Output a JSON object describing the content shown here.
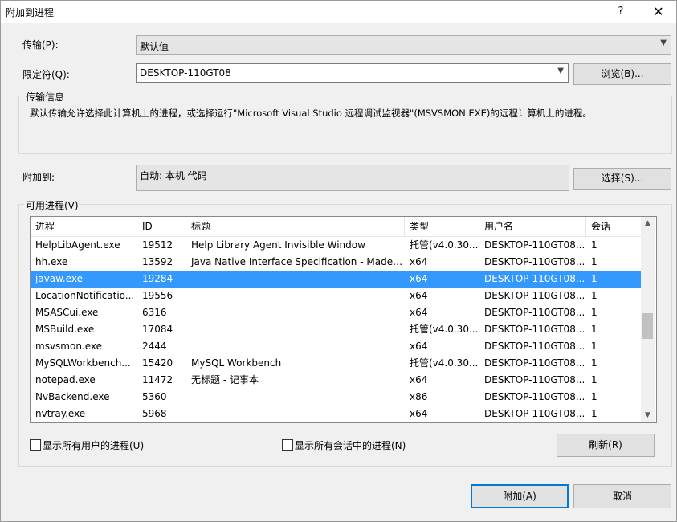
{
  "window": {
    "title": "附加到进程",
    "help_glyph": "?",
    "close_glyph": "✕"
  },
  "transport": {
    "label": "传输(P):",
    "value": "默认值"
  },
  "qualifier": {
    "label": "限定符(Q):",
    "value": "DESKTOP-110GT08"
  },
  "browse_button": "浏览(B)...",
  "transport_info": {
    "title": "传输信息",
    "text": "默认传输允许选择此计算机上的进程，或选择运行\"Microsoft Visual Studio 远程调试监视器\"(MSVSMON.EXE)的远程计算机上的进程。"
  },
  "attach_to": {
    "label": "附加到:",
    "value": "自动: 本机 代码"
  },
  "select_button": "选择(S)...",
  "available_processes": {
    "title": "可用进程(V)",
    "columns": [
      "进程",
      "ID",
      "标题",
      "类型",
      "用户名",
      "会话"
    ],
    "rows": [
      [
        "HelpLibAgent.exe",
        "19512",
        "Help Library Agent Invisible Window",
        "托管(v4.0.30...",
        "DESKTOP-110GT08...",
        "1"
      ],
      [
        "hh.exe",
        "13592",
        "Java Native Interface Specification - Made ...",
        "x64",
        "DESKTOP-110GT08...",
        "1"
      ],
      [
        "javaw.exe",
        "19284",
        "",
        "x64",
        "DESKTOP-110GT08...",
        "1"
      ],
      [
        "LocationNotificatio...",
        "19556",
        "",
        "x64",
        "DESKTOP-110GT08...",
        "1"
      ],
      [
        "MSASCui.exe",
        "6316",
        "",
        "x64",
        "DESKTOP-110GT08...",
        "1"
      ],
      [
        "MSBuild.exe",
        "17084",
        "",
        "托管(v4.0.30...",
        "DESKTOP-110GT08...",
        "1"
      ],
      [
        "msvsmon.exe",
        "2444",
        "",
        "x64",
        "DESKTOP-110GT08...",
        "1"
      ],
      [
        "MySQLWorkbench...",
        "15420",
        "MySQL Workbench",
        "托管(v4.0.30...",
        "DESKTOP-110GT08...",
        "1"
      ],
      [
        "notepad.exe",
        "11472",
        "无标题 - 记事本",
        "x64",
        "DESKTOP-110GT08...",
        "1"
      ],
      [
        "NvBackend.exe",
        "5360",
        "",
        "x86",
        "DESKTOP-110GT08...",
        "1"
      ],
      [
        "nvtray.exe",
        "5968",
        "",
        "x64",
        "DESKTOP-110GT08...",
        "1"
      ]
    ],
    "selected_row": 2
  },
  "show_all_users": "显示所有用户的进程(U)",
  "show_all_sessions": "显示所有会话中的进程(N)",
  "refresh_button": "刷新(R)",
  "attach_button": "附加(A)",
  "cancel_button": "取消",
  "colors": {
    "selection": "#3399ff",
    "primary_border": "#0078d7",
    "dialog_bg": "#f0f0f0"
  }
}
